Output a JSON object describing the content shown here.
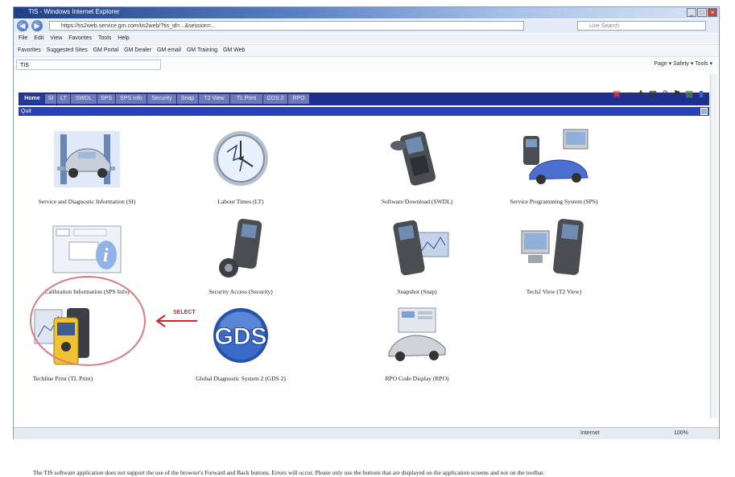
{
  "browser": {
    "title": "TIS - Windows Internet Explorer",
    "address": "https://tis2web.service.gm.com/tis2web/?tis_id=...&session=...",
    "search_placeholder": "Live Search",
    "menu": [
      "File",
      "Edit",
      "View",
      "Favorites",
      "Tools",
      "Help"
    ],
    "favorites": [
      "Favorites",
      "Suggested Sites",
      "GM Portal",
      "GM Dealer",
      "GM email",
      "GM Training",
      "GM Web"
    ],
    "current_tab": "TIS",
    "command_bar": "Page ▾  Safety ▾  Tools ▾",
    "status_zone": "Internet",
    "zoom": "100%"
  },
  "tis": {
    "nav_tabs": [
      "Home",
      "SI",
      "LT",
      "SWDL",
      "SPS",
      "SPS Info",
      "Security",
      "Snap",
      "T2 View",
      "TL Print",
      "GDS 2",
      "RPO"
    ],
    "active_tab": "Home",
    "subbar_label": "Quit",
    "tiles": [
      {
        "label": "Service and Diagnostic Information (SI)",
        "icon": "service-info-icon"
      },
      {
        "label": "Labour Times (LT)",
        "icon": "labour-times-clock-icon"
      },
      {
        "label": "Software Download (SWDL)",
        "icon": "software-download-icon"
      },
      {
        "label": "Service Programming System (SPS)",
        "icon": "service-programming-icon"
      },
      {
        "label": "Calibration Information (SPS Info)",
        "icon": "calibration-info-icon"
      },
      {
        "label": "Security Access (Security)",
        "icon": "security-access-icon"
      },
      {
        "label": "Snapshot (Snap)",
        "icon": "snapshot-icon"
      },
      {
        "label": "Tech2 View (T2 View)",
        "icon": "tech2-view-icon"
      },
      {
        "label": "Techline Print (TL Print)",
        "icon": "techline-print-icon"
      },
      {
        "label": "Global Diagnostic System 2 (GDS 2)",
        "icon": "gds2-icon"
      },
      {
        "label": "RPO Code Display (RPO)",
        "icon": "rpo-code-icon"
      }
    ],
    "callout": "SELECT",
    "gds_logo": "GDS",
    "note": "The TIS software application does not support the use of the browser's Forward and Back buttons. Errors will occur. Please only use the buttons that are displayed on the application screens and not on the toolbar."
  }
}
